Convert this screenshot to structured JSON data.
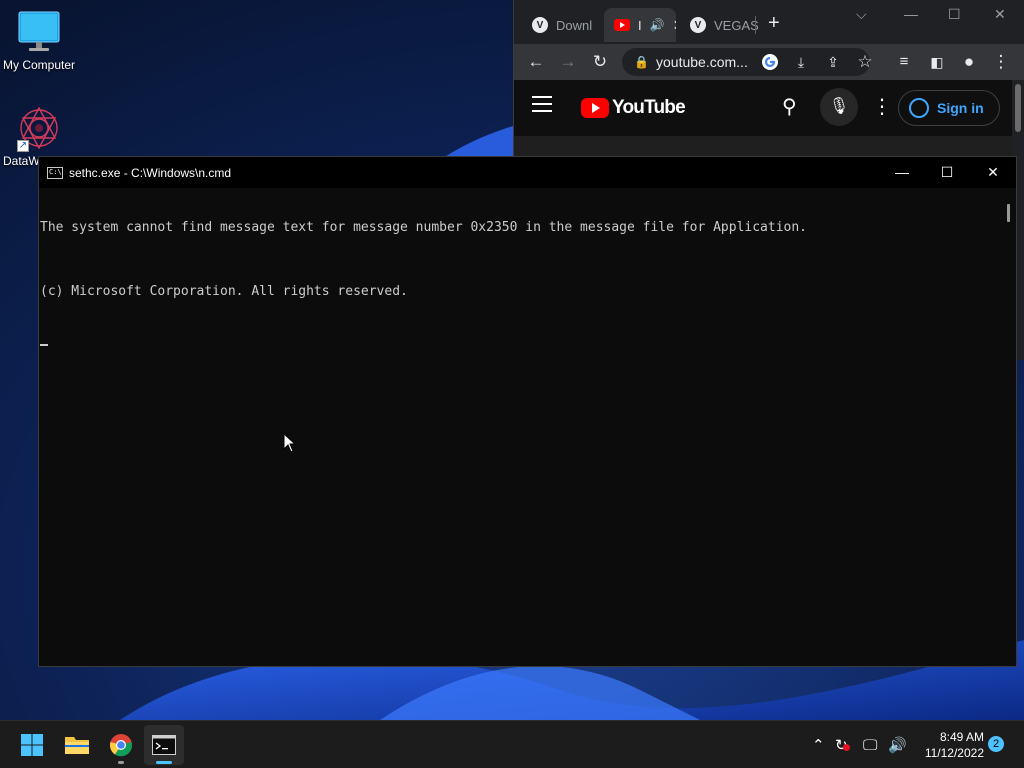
{
  "desktop": {
    "icons": [
      {
        "label": "My Computer",
        "icon": "monitor-icon"
      },
      {
        "label": "DataW",
        "icon": "datawrapper-icon"
      }
    ]
  },
  "browser": {
    "tabs": [
      {
        "label": "Downl",
        "favicon": "V"
      },
      {
        "label": "I",
        "favicon": "youtube",
        "audio": true
      },
      {
        "label": "VEGAS",
        "favicon": "V"
      }
    ],
    "new_tab_label": "+",
    "address": "youtube.com...",
    "youtube": {
      "logo_text": "YouTube",
      "sign_in_label": "Sign in"
    }
  },
  "cmd": {
    "title": "sethc.exe - C:\\Windows\\n.cmd",
    "lines": [
      "The system cannot find message text for message number 0x2350 in the message file for Application.",
      "(c) Microsoft Corporation. All rights reserved."
    ]
  },
  "taskbar": {
    "apps": [
      "start-icon",
      "file-explorer-icon",
      "chrome-icon",
      "terminal-icon"
    ],
    "clock_time": "8:49 AM",
    "clock_date": "11/12/2022",
    "notification_count": "2"
  },
  "colors": {
    "youtube_red": "#ff0000",
    "accent_blue": "#4cc2ff",
    "signin_blue": "#3ea6ff"
  }
}
